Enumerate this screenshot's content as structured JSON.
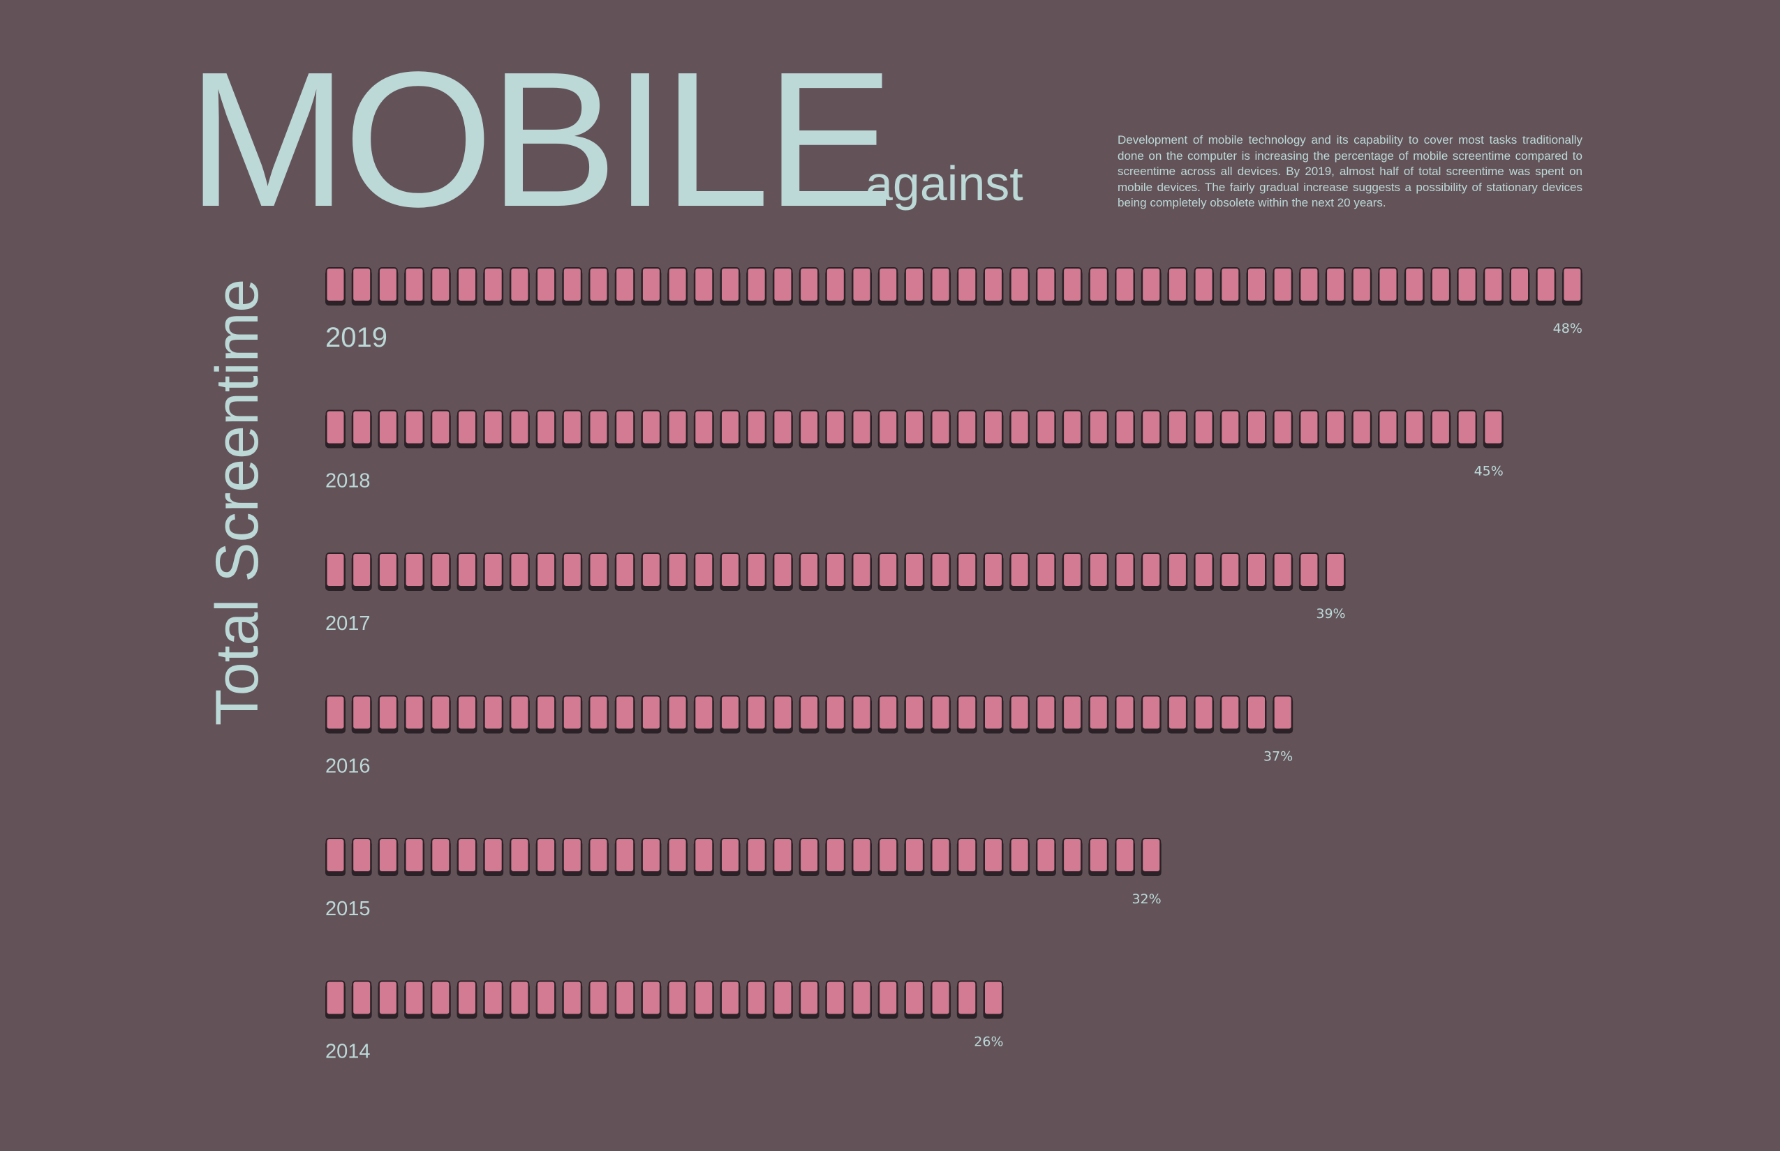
{
  "title": "MOBILE",
  "subtitle": "against",
  "description": "Development of mobile technology and its capability to cover most tasks traditionally done on the computer is increasing the percentage of mobile screentime compared to screentime across all devices. By 2019, almost half of total screentime was spent on mobile devices. The fairly gradual increase suggests a possibility of stationary devices being completely obsolete within the next 20 years.",
  "side_label": "Total Screentime",
  "colors": {
    "background": "#635358",
    "accent_text": "#bcd8d7",
    "phone_fill": "#d27b93",
    "phone_shadow": "#2b2227"
  },
  "chart_data": {
    "type": "bar",
    "categories": [
      "2019",
      "2018",
      "2017",
      "2016",
      "2015",
      "2014"
    ],
    "values": [
      48,
      45,
      39,
      37,
      32,
      26
    ],
    "value_labels": [
      "48%",
      "45%",
      "39%",
      "37%",
      "32%",
      "26%"
    ],
    "unit": "%",
    "icon": "phone-icon",
    "icons_per_row": [
      48,
      45,
      39,
      37,
      32,
      26
    ]
  }
}
